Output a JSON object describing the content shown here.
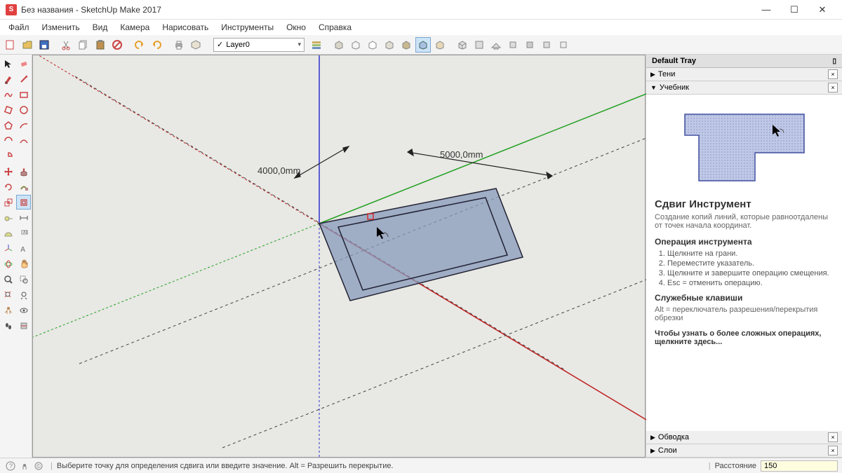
{
  "titlebar": {
    "app_icon": "S",
    "title": "Без названия - SketchUp Make 2017",
    "minimize": "—",
    "maximize": "☐",
    "close": "✕"
  },
  "menu": {
    "file": "Файл",
    "edit": "Изменить",
    "view": "Вид",
    "camera": "Камера",
    "draw": "Нарисовать",
    "tools": "Инструменты",
    "window": "Окно",
    "help": "Справка"
  },
  "toolbar": {
    "layer_checked": "✓",
    "layer_value": "Layer0",
    "dropdown_arrow": "▾"
  },
  "canvas": {
    "dim_left": "4000,0mm",
    "dim_right": "5000,0mm"
  },
  "tray": {
    "header": "Default Tray",
    "shadows": "Тени",
    "instructor": "Учебник",
    "outline": "Обводка",
    "layers": "Слои",
    "arrow_right": "▶",
    "arrow_down": "▼",
    "close_x": "×",
    "pin": "📌"
  },
  "instructor_panel": {
    "title": "Сдвиг Инструмент",
    "desc": "Создание копий линий, которые равноотдалены от точек начала координат.",
    "op_title": "Операция инструмента",
    "step1": "Щелкните на грани.",
    "step2": "Переместите указатель.",
    "step3": "Щелкните и завершите операцию смещения.",
    "step4": "Esc = отменить операцию.",
    "keys_title": "Служебные клавиши",
    "keys_text": "Alt = переключатель разрешения/перекрытия обрезки",
    "more": "Чтобы узнать о более сложных операциях, щелкните здесь..."
  },
  "statusbar": {
    "message": "Выберите точку для определения сдвига или введите значение. Alt = Разрешить перекрытие.",
    "distance_label": "Расстояние",
    "distance_value": "150"
  }
}
